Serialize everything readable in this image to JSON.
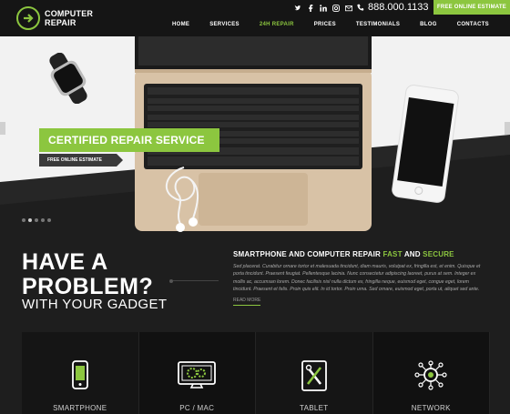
{
  "brand": {
    "line1": "COMPUTER",
    "line2": "REPAIR"
  },
  "header": {
    "phone": "888.000.1133",
    "estimate_button": "FREE ONLINE ESTIMATE",
    "social": [
      "twitter-icon",
      "facebook-icon",
      "linkedin-icon",
      "instagram-icon",
      "email-icon"
    ]
  },
  "nav": [
    {
      "label": "HOME",
      "active": false
    },
    {
      "label": "SERVICES",
      "active": false
    },
    {
      "label": "24H REPAIR",
      "active": true
    },
    {
      "label": "PRICES",
      "active": false
    },
    {
      "label": "TESTIMONIALS",
      "active": false
    },
    {
      "label": "BLOG",
      "active": false
    },
    {
      "label": "CONTACTS",
      "active": false
    }
  ],
  "hero": {
    "certified": "CERTIFIED REPAIR SERVICE",
    "estimate_tag": "FREE ONLINE ESTIMATE"
  },
  "problem": {
    "headline": "HAVE A PROBLEM?",
    "subline": "WITH YOUR GADGET",
    "heading_prefix": "SMARTPHONE AND COMPUTER REPAIR ",
    "heading_fast": "FAST",
    "heading_and": " AND ",
    "heading_secure": "SECURE",
    "paragraph": "Sed placerat. Curabitur ornare tortor et malesuada tincidunt, diam mauris, volutpat ex, fringilla est, et enim. Quisque et porta tincidunt. Praesent feugiat. Pellentesque lacinia. Nunc consectetur adipiscing laoreet, purus at sem. Integer ex mollis ac, accumsan lorem. Donec facilisis nisl nulla dictum ex, fringilla neque, euismod eget, congue eget, lorem tincidunt. Praesent et felis. Proin quis elit. In id tortor. Proin urna. Sed ornare, euismod eget, porta ut, aliquet sed ante.",
    "read_more": "READ MORE"
  },
  "services": [
    {
      "label": "SMARTPHONE",
      "icon": "smartphone-icon"
    },
    {
      "label": "PC / MAC",
      "icon": "monitor-gear-icon"
    },
    {
      "label": "TABLET",
      "icon": "tablet-tools-icon"
    },
    {
      "label": "NETWORK",
      "icon": "network-icon"
    }
  ],
  "colors": {
    "accent": "#8cc63f",
    "dark": "#151515"
  }
}
